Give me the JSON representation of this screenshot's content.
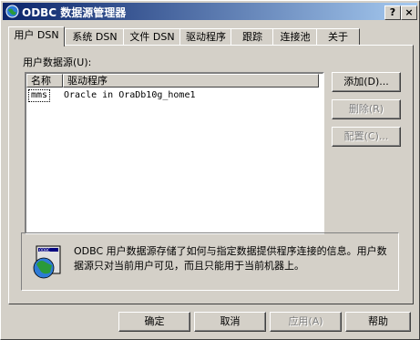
{
  "window": {
    "title": "ODBC 数据源管理器",
    "help_button": "?",
    "close_button": "×"
  },
  "tabs": [
    "用户 DSN",
    "系统 DSN",
    "文件 DSN",
    "驱动程序",
    "跟踪",
    "连接池",
    "关于"
  ],
  "active_tab": "用户 DSN",
  "user_dsn": {
    "list_label": "用户数据源(U):",
    "columns": [
      "名称",
      "驱动程序"
    ],
    "rows": [
      {
        "name": "mms",
        "driver": "Oracle in OraDb10g_home1"
      }
    ],
    "buttons": {
      "add": "添加(D)...",
      "remove": "删除(R)",
      "configure": "配置(C)..."
    },
    "info_text": "ODBC 用户数据源存储了如何与指定数据提供程序连接的信息。用户数据源只对当前用户可见，而且只能用于当前机器上。"
  },
  "footer": {
    "ok": "确定",
    "cancel": "取消",
    "apply": "应用(A)",
    "help": "帮助"
  }
}
